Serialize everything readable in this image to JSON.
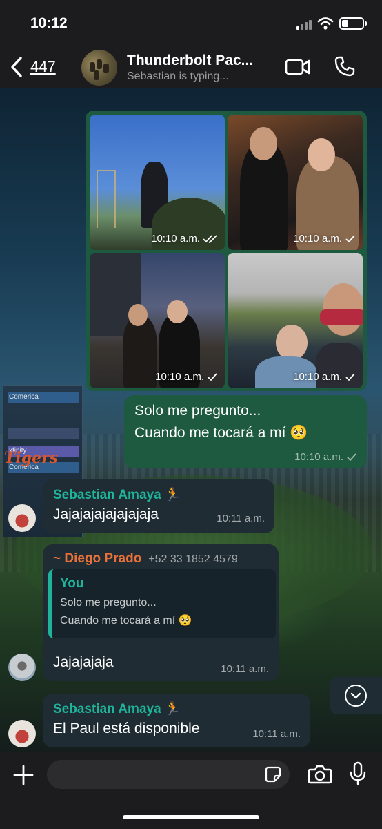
{
  "status_bar": {
    "time": "10:12"
  },
  "header": {
    "back_count": "447",
    "title": "Thunderbolt Pac...",
    "subtitle": "Sebastian is typing..."
  },
  "album": {
    "photos": [
      {
        "time": "10:10 a.m.",
        "status": "read"
      },
      {
        "time": "10:10 a.m.",
        "status": "sent"
      },
      {
        "time": "10:10 a.m.",
        "status": "sent"
      },
      {
        "time": "10:10 a.m.",
        "status": "sent"
      }
    ]
  },
  "messages": [
    {
      "type": "outgoing",
      "lines": [
        "Solo me pregunto...",
        "Cuando me tocará a mí 🥺"
      ],
      "time": "10:10 a.m.",
      "status": "sent"
    },
    {
      "type": "incoming",
      "sender": "Sebastian Amaya 🏃",
      "text": "Jajajajajajajajaja",
      "time": "10:11 a.m."
    },
    {
      "type": "incoming",
      "sender": "~ Diego Prado",
      "phone": "+52 33 1852 4579",
      "quote_sender": "You",
      "quote_lines": [
        "Solo me pregunto...",
        "Cuando me tocará a mí 🥺"
      ],
      "text": "Jajajajaja",
      "time": "10:11 a.m."
    },
    {
      "type": "incoming",
      "sender": "Sebastian Amaya 🏃",
      "text": "El Paul está disponible",
      "time": "10:11 a.m."
    }
  ],
  "wallpaper": {
    "sign_text": "Tigers",
    "board_labels": [
      "Comerica",
      "xfinity",
      "Comerica"
    ]
  },
  "composer": {
    "placeholder": ""
  },
  "colors": {
    "outgoing_bubble": "#1e5a3f",
    "incoming_bubble": "#1f2c34",
    "sender_teal": "#1fb49a",
    "sender_orange": "#e8703a"
  }
}
